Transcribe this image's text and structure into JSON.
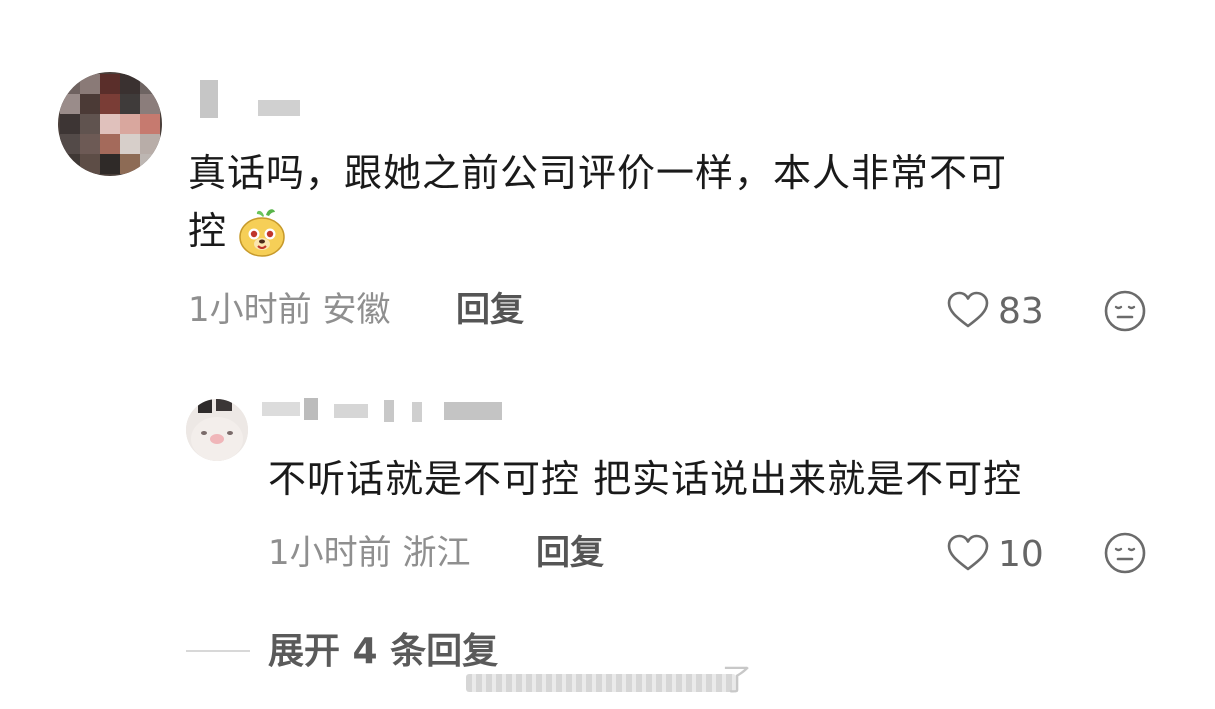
{
  "main_comment": {
    "text_line1": "真话吗，跟她之前公司评价一样，本人非常不可",
    "text_line2": "控",
    "emoji": "dog-emoji",
    "time": "1小时前",
    "location": "安徽",
    "reply_label": "回复",
    "likes": "83",
    "like_icon": "heart-outline-icon",
    "reaction_icon": "meh-face-icon"
  },
  "reply_comment": {
    "text": "不听话就是不可控 把实话说出来就是不可控",
    "time": "1小时前",
    "location": "浙江",
    "reply_label": "回复",
    "likes": "10",
    "like_icon": "heart-outline-icon",
    "reaction_icon": "meh-face-icon"
  },
  "expand": {
    "label": "展开 4 条回复"
  },
  "watermark": {
    "suffix": "了"
  },
  "colors": {
    "text": "#1a1a1a",
    "meta": "#8f8f8f",
    "reply": "#555555",
    "background": "#ffffff"
  }
}
